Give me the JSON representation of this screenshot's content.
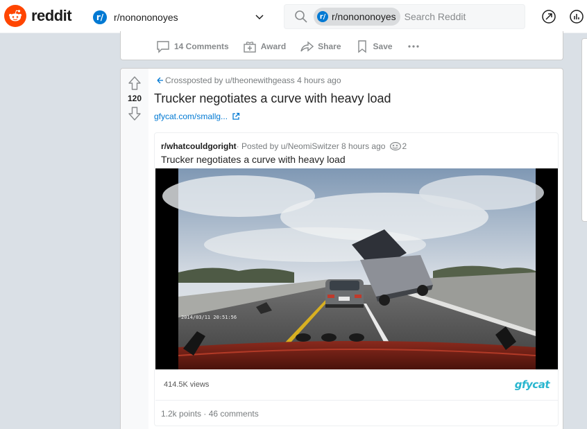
{
  "header": {
    "logo_text": "reddit",
    "community_icon_text": "r/",
    "community_name": "r/nonononoyes",
    "search_chip": "r/nonononoyes",
    "search_placeholder": "Search Reddit"
  },
  "prev_post": {
    "actions": {
      "comments": "14 Comments",
      "award": "Award",
      "share": "Share",
      "save": "Save"
    }
  },
  "post": {
    "votes": "120",
    "crosspost_meta": "Crossposted by u/theonewithgeass 4 hours ago",
    "title": "Trucker negotiates a curve with heavy load",
    "link": "gfycat.com/smallg...",
    "embed": {
      "subreddit": "r/whatcouldgoright",
      "meta": " · Posted by u/NeomiSwitzer 8 hours ago",
      "award_count": "2",
      "title": "Trucker negotiates a curve with heavy load",
      "video_timestamp": "2014/03/11  20:51:56",
      "views": "414.5K views",
      "provider": "gfycat",
      "footer": "1.2k points · 46 comments"
    }
  },
  "colors": {
    "brand": "#ff4500",
    "link": "#0079d3",
    "meta": "#787c7e",
    "page_bg": "#dae0e6"
  }
}
